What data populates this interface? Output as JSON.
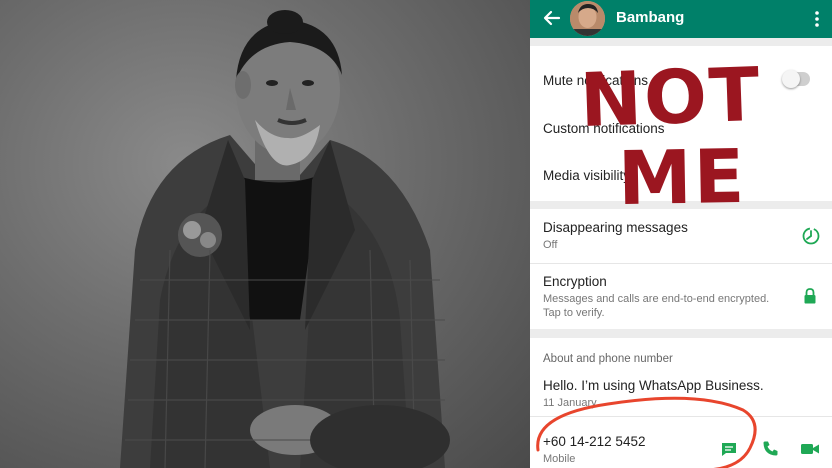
{
  "header": {
    "contact_name": "Bambang",
    "accent_color": "#008069",
    "icons": [
      "back-arrow-icon",
      "contact-avatar",
      "overflow-menu-icon"
    ]
  },
  "settings": {
    "mute_label": "Mute notifications",
    "custom_label": "Custom notifications",
    "media_label": "Media visibility",
    "disappearing_label": "Disappearing messages",
    "disappearing_value": "Off",
    "encryption_label": "Encryption",
    "encryption_desc_line1": "Messages and calls are end-to-end encrypted.",
    "encryption_desc_line2": "Tap to verify."
  },
  "about": {
    "section_title": "About and phone number",
    "status": "Hello. I’m using WhatsApp Business.",
    "status_date": "11 January",
    "phone": "+60 14-212 5452",
    "phone_type": "Mobile"
  },
  "overlay": {
    "line1": "NOT",
    "line2": "ME",
    "color": "#9b1620"
  }
}
